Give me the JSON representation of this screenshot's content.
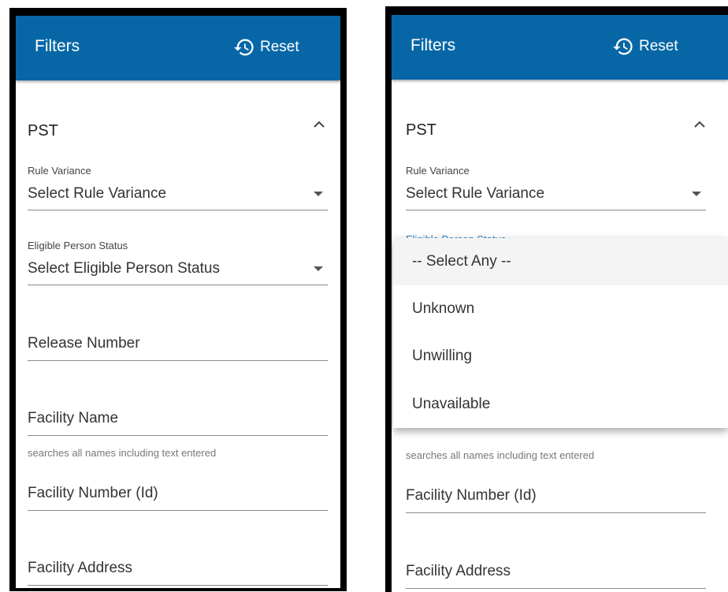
{
  "filters": {
    "title": "Filters",
    "reset_label": "Reset",
    "section_title": "PST",
    "rule_variance": {
      "label": "Rule Variance",
      "placeholder": "Select Rule Variance"
    },
    "eligible_status": {
      "label": "Eligible Person Status",
      "placeholder": "Select Eligible Person Status"
    },
    "release_number": {
      "placeholder": "Release Number"
    },
    "facility_name": {
      "placeholder": "Facility Name",
      "hint": "searches all names including text entered"
    },
    "facility_number": {
      "placeholder": "Facility Number (Id)"
    },
    "facility_address": {
      "placeholder": "Facility Address"
    }
  },
  "dropdown": {
    "peek_label": "Eligible Person Status",
    "options": [
      "-- Select Any --",
      "Unknown",
      "Unwilling",
      "Unavailable"
    ],
    "highlighted_index": 0
  },
  "colors": {
    "header": "#0767a6",
    "border": "#000000"
  },
  "icons": {
    "reset": "history-icon",
    "collapse": "chevron-up-icon",
    "select": "caret-down-icon"
  }
}
